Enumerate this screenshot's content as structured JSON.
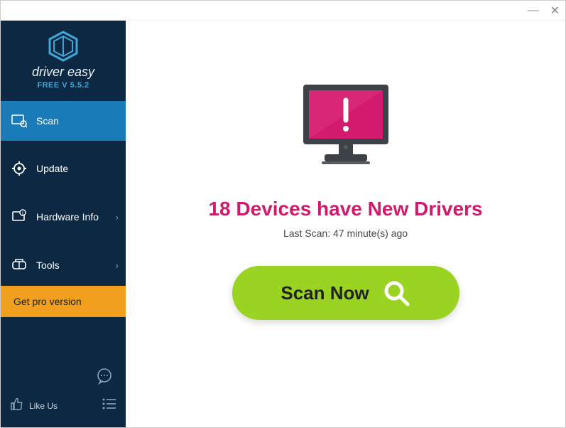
{
  "app": {
    "name": "driver easy",
    "version_label": "FREE V 5.5.2"
  },
  "sidebar": {
    "items": {
      "scan": "Scan",
      "update": "Update",
      "hardware": "Hardware Info",
      "tools": "Tools"
    },
    "pro_label": "Get pro version",
    "like_label": "Like Us"
  },
  "main": {
    "headline": "18 Devices have New Drivers",
    "subline": "Last Scan: 47 minute(s) ago",
    "scan_button": "Scan Now"
  }
}
